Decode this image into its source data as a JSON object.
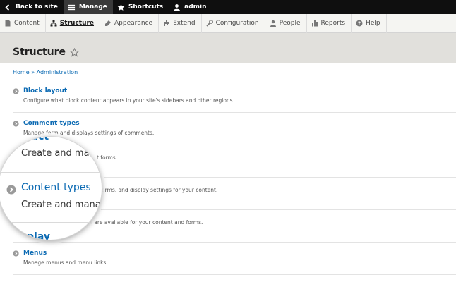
{
  "toolbar": {
    "back_label": "Back to site",
    "manage_label": "Manage",
    "shortcuts_label": "Shortcuts",
    "user_label": "admin"
  },
  "tray": {
    "items": [
      {
        "label": "Content",
        "icon": "content-icon"
      },
      {
        "label": "Structure",
        "icon": "structure-icon",
        "active": true
      },
      {
        "label": "Appearance",
        "icon": "appearance-icon"
      },
      {
        "label": "Extend",
        "icon": "extend-icon"
      },
      {
        "label": "Configuration",
        "icon": "configuration-icon"
      },
      {
        "label": "People",
        "icon": "people-icon"
      },
      {
        "label": "Reports",
        "icon": "reports-icon"
      },
      {
        "label": "Help",
        "icon": "help-icon"
      }
    ]
  },
  "page": {
    "title": "Structure"
  },
  "breadcrumb": {
    "home": "Home",
    "separator": " » ",
    "admin": "Administration"
  },
  "admin_list": [
    {
      "title": "Block layout",
      "description": "Configure what block content appears in your site's sidebars and other regions."
    },
    {
      "title": "Comment types",
      "description": "Manage form and displays settings of comments."
    },
    {
      "title": "",
      "description": "t forms."
    },
    {
      "title": "",
      "description": "orms, and display settings for your content."
    },
    {
      "title": "",
      "description": "ays are available for your content and forms."
    },
    {
      "title": "Menus",
      "description": "Manage menus and menu links."
    }
  ],
  "magnifier": {
    "top_title": "ntact",
    "desc1": "Create and man",
    "title2": "Content types",
    "desc2": "Create and manag",
    "bottom_title": "play"
  },
  "colors": {
    "toolbar_bg": "#0f0f0f",
    "link": "#0b6ab3",
    "header_bg": "#e1e0dc"
  }
}
